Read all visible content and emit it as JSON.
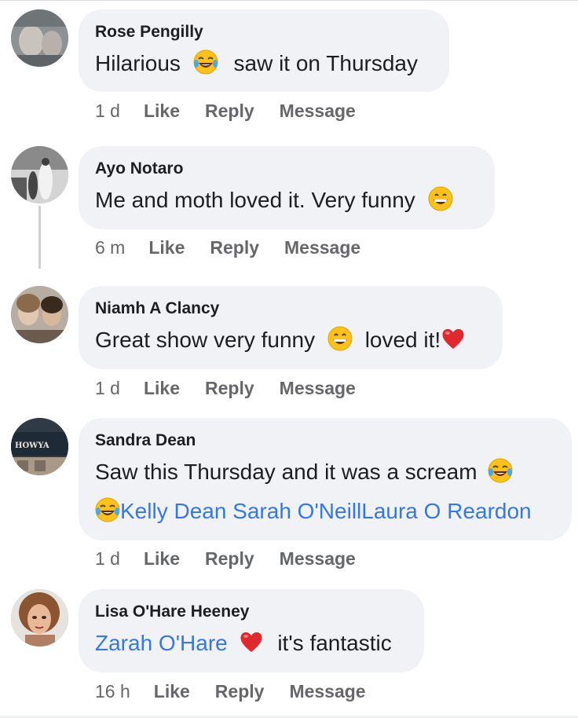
{
  "comments": [
    {
      "name": "Rose Pengilly",
      "text_before": "Hilarious",
      "text_after": "saw it on Thursday",
      "time": "1 d",
      "like": "Like",
      "reply": "Reply",
      "message": "Message"
    },
    {
      "name": "Ayo Notaro",
      "text_before": "Me and moth loved it. Very funny",
      "time": "6 m",
      "like": "Like",
      "reply": "Reply",
      "message": "Message"
    },
    {
      "name": "Niamh A Clancy",
      "text_before": "Great show very funny",
      "text_after": "loved it!",
      "time": "1 d",
      "like": "Like",
      "reply": "Reply",
      "message": "Message"
    },
    {
      "name": "Sandra Dean",
      "text_before": "Saw this Thursday and it was a scream",
      "tags": "Kelly Dean Sarah O'NeillLaura O Reardon",
      "avatar_text": "HOWYA",
      "time": "1 d",
      "like": "Like",
      "reply": "Reply",
      "message": "Message"
    },
    {
      "name": "Lisa O'Hare Heeney",
      "tag": "Zarah O'Hare",
      "text_after": "it's fantastic",
      "time": "16 h",
      "like": "Like",
      "reply": "Reply",
      "message": "Message"
    }
  ],
  "icons": {
    "laugh_cry": "face-with-tears-of-joy-icon",
    "grin": "grinning-face-icon",
    "heart": "red-heart-icon"
  },
  "colors": {
    "bubble": "#f0f2f5",
    "link": "#3578e5",
    "meta": "#65676b",
    "name": "#1c1e21",
    "heart": "#e0282f",
    "emoji_face": "#fcc21b"
  }
}
